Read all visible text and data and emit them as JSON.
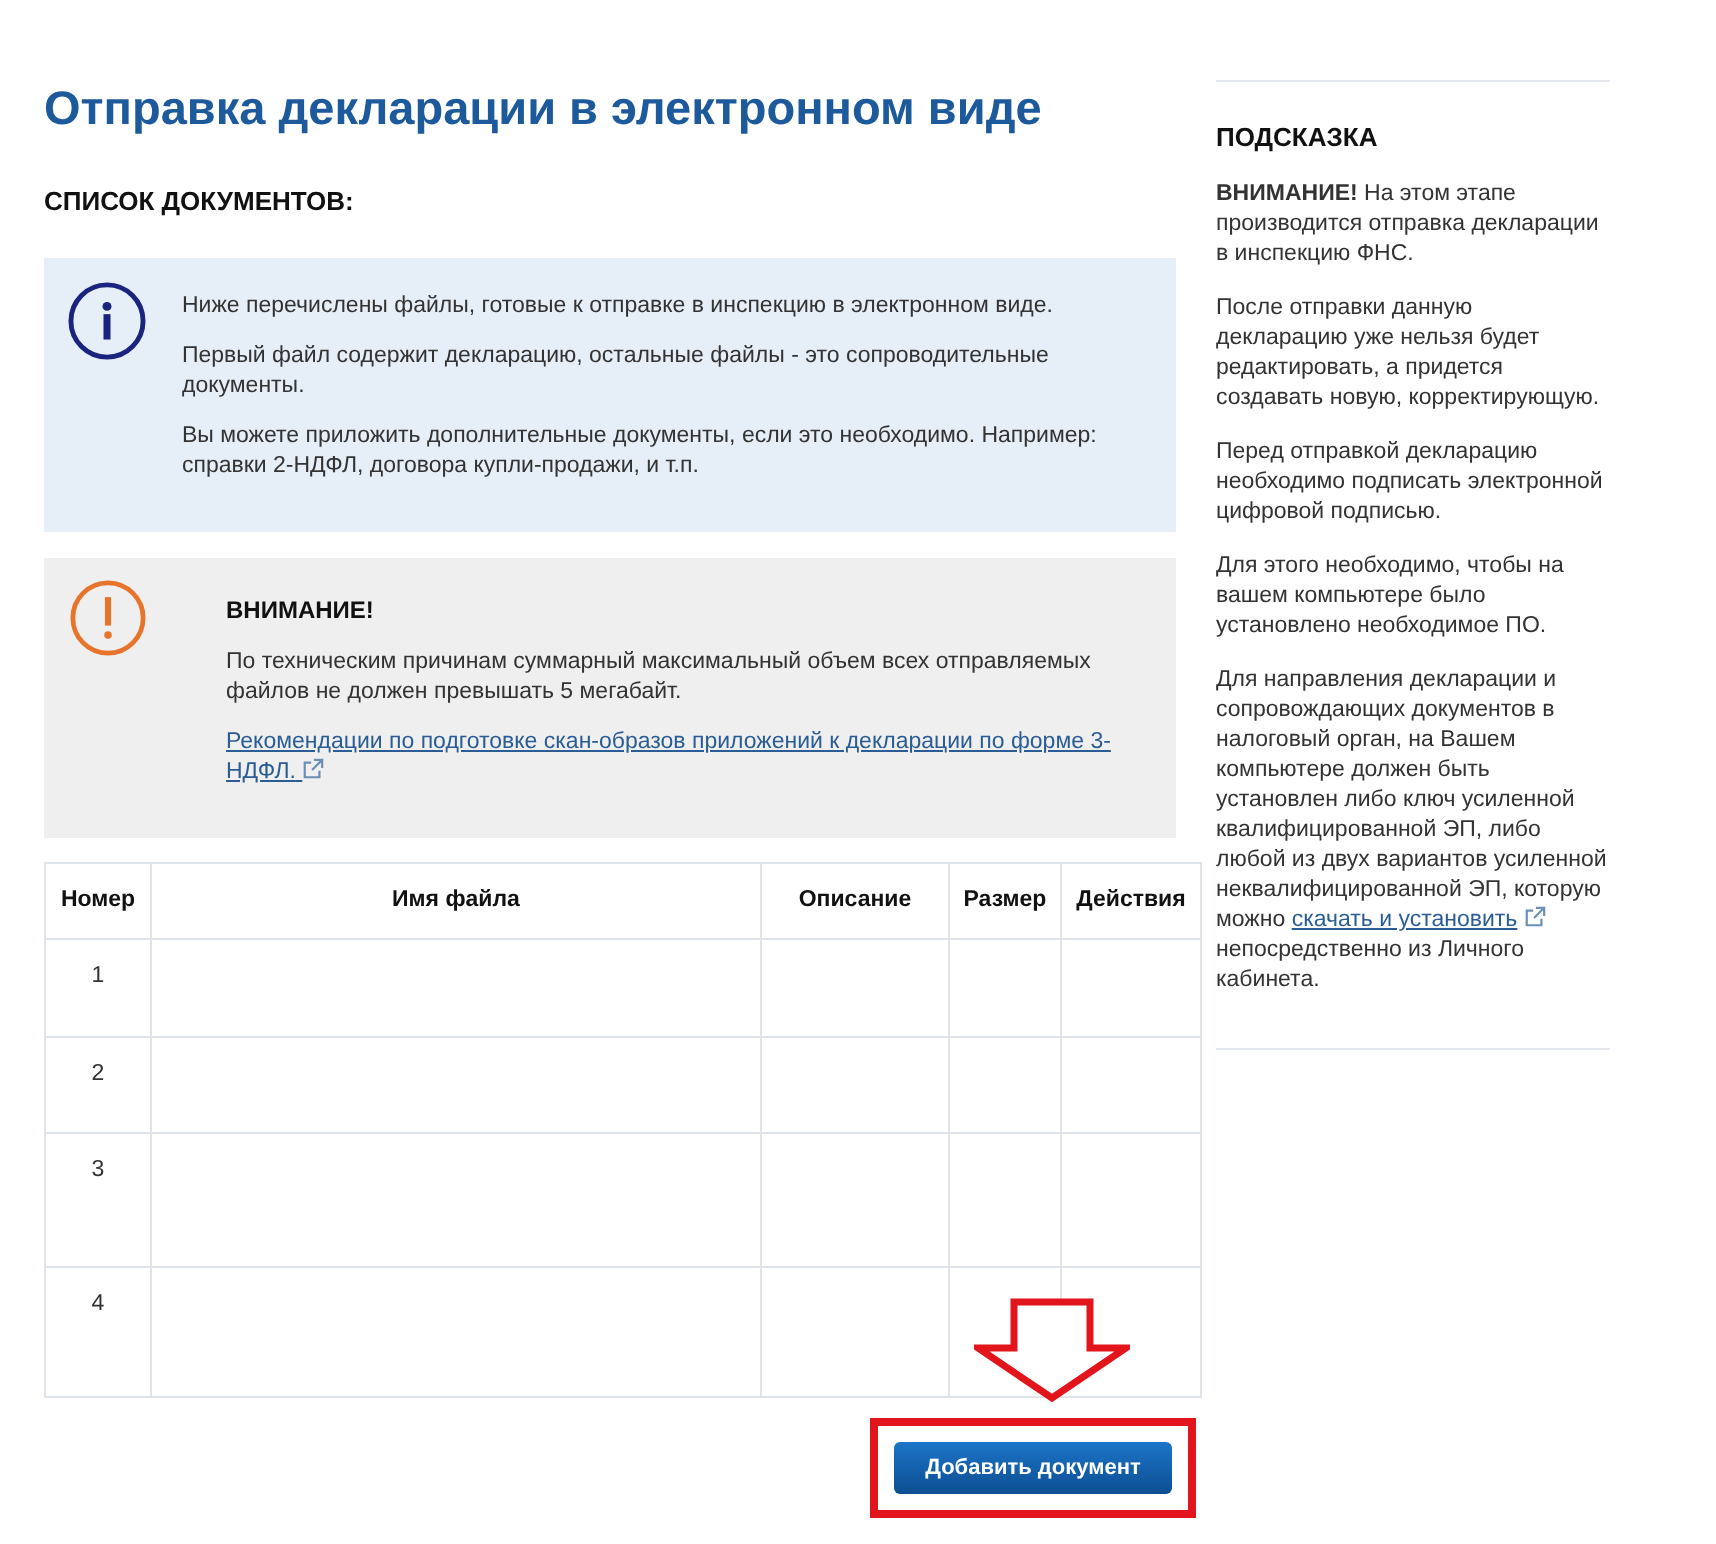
{
  "page": {
    "title": "Отправка декларации в электронном виде",
    "section_heading": "СПИСОК ДОКУМЕНТОВ:"
  },
  "info_box": {
    "paragraphs": [
      "Ниже перечислены файлы, готовые к отправке в инспекцию в электронном виде.",
      "Первый файл содержит декларацию, остальные файлы - это сопроводительные документы.",
      "Вы можете приложить дополнительные документы, если это необходимо. Например: справки 2-НДФЛ, договора купли-продажи, и т.п."
    ]
  },
  "warning_box": {
    "heading": "ВНИМАНИЕ!",
    "text": "По техническим причинам суммарный максимальный объем всех отправляемых файлов не должен превышать 5 мегабайт.",
    "link": "Рекомендации по подготовке скан-образов приложений к декларации по форме 3-НДФЛ."
  },
  "table": {
    "columns": [
      "Номер",
      "Имя файла",
      "Описание",
      "Размер",
      "Действия"
    ],
    "rows": [
      {
        "number": "1"
      },
      {
        "number": "2"
      },
      {
        "number": "3"
      },
      {
        "number": "4"
      }
    ]
  },
  "add_button": {
    "label": "Добавить документ"
  },
  "sidebar": {
    "heading": "ПОДСКАЗКА",
    "paragraphs": [
      {
        "text": "**ВНИМАНИЕ!** На этом этапе производится отправка декларации в инспекцию ФНС."
      },
      {
        "text": "После отправки данную декларацию уже нельзя будет редактировать, а придется создавать новую, корректирующую."
      },
      {
        "text": "Перед отправкой декларацию необходимо подписать электронной цифровой подписью."
      },
      {
        "text": "Для этого необходимо, чтобы на вашем компьютере было установлено необходимое ПО."
      },
      {
        "text": "Для направления декларации и сопровождающих документов в налоговый орган, на Вашем компьютере должен быть установлен либо ключ усиленной квалифицированной ЭП, либо любой из двух вариантов усиленной неквалифицированной ЭП, которую можно",
        "link": "скачать и установить",
        "text_after": "непосредственно из Личного кабинета."
      }
    ]
  }
}
